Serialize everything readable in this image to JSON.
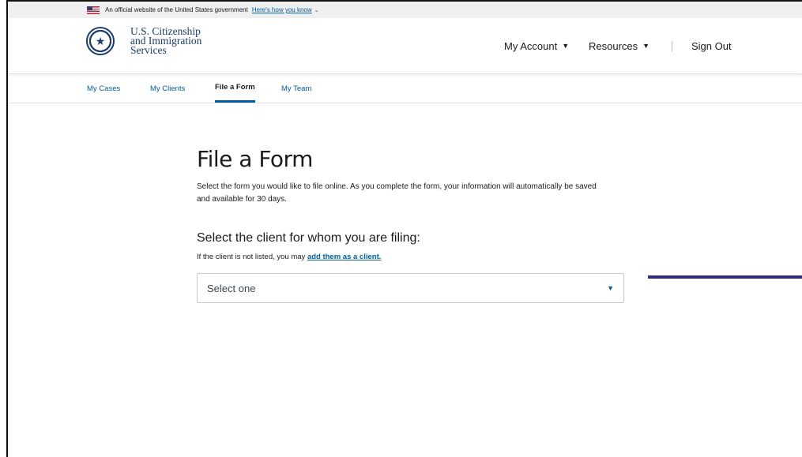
{
  "gov_banner": {
    "text": "An official website of the United States government",
    "link": "Here's how you know"
  },
  "header": {
    "agency_line1": "U.S. Citizenship",
    "agency_line2": "and Immigration",
    "agency_line3": "Services",
    "nav": {
      "account": "My Account",
      "resources": "Resources",
      "sign_out": "Sign Out"
    }
  },
  "tabs": [
    "My Cases",
    "My Clients",
    "File a Form",
    "My Team"
  ],
  "main": {
    "title": "File a Form",
    "intro": "Select the form you would like to file online. As you complete the form, your information will automatically be saved and available for 30 days.",
    "client_heading": "Select the client for whom you are filing:",
    "hint_prefix": "If the client is not listed, you may ",
    "hint_link": "add them as a client.",
    "select_value": "Select one"
  },
  "colors": {
    "link": "#005ea2",
    "connector": "#2e2b83"
  }
}
